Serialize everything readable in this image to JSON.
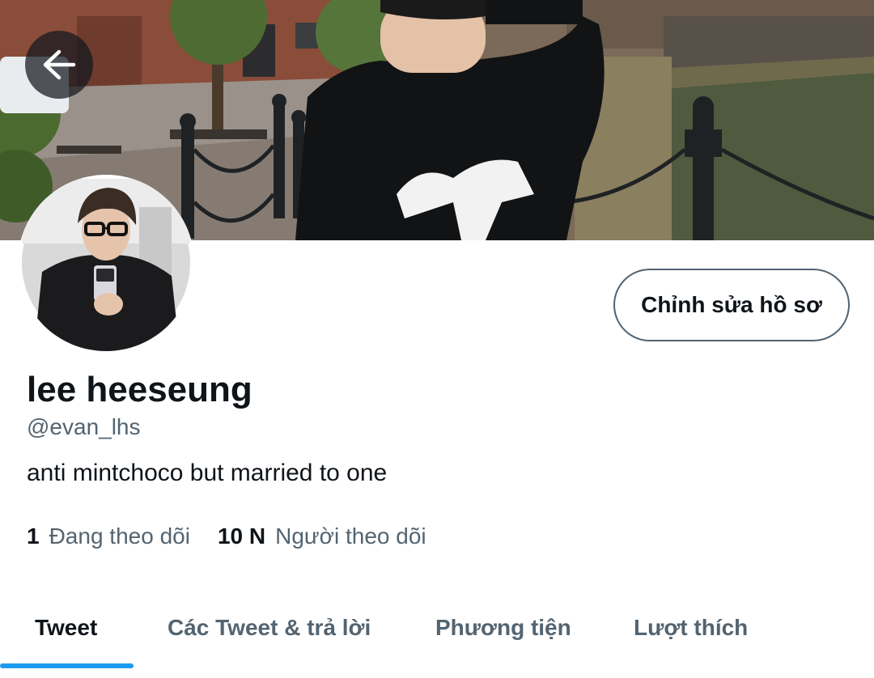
{
  "profile": {
    "display_name": "lee heeseung",
    "handle": "@evan_lhs",
    "bio": "anti mintchoco but married to one",
    "edit_label": "Chỉnh sửa hồ sơ"
  },
  "stats": [
    {
      "value": "1",
      "label": "Đang theo dõi"
    },
    {
      "value": "10 N",
      "label": "Người theo dõi"
    }
  ],
  "tabs": [
    {
      "label": "Tweet",
      "active": true
    },
    {
      "label": "Các Tweet & trả lời",
      "active": false
    },
    {
      "label": "Phương tiện",
      "active": false
    },
    {
      "label": "Lượt thích",
      "active": false
    }
  ],
  "icons": {
    "back": "arrow-left-icon"
  },
  "colors": {
    "accent": "#1d9bf0",
    "text_primary": "#0f1419",
    "text_secondary": "#536471"
  }
}
